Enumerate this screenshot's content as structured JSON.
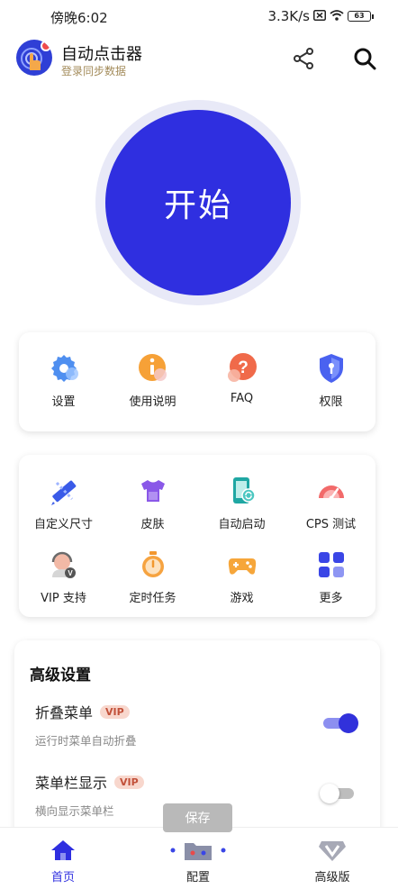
{
  "status_bar": {
    "time": "傍晚6:02",
    "speed": "3.3K/s",
    "battery": "63"
  },
  "header": {
    "title": "自动点击器",
    "subtitle": "登录同步数据"
  },
  "start": {
    "label": "开始"
  },
  "quick_menu": [
    {
      "label": "设置",
      "icon": "gear-icon"
    },
    {
      "label": "使用说明",
      "icon": "info-icon"
    },
    {
      "label": "FAQ",
      "icon": "question-icon"
    },
    {
      "label": "权限",
      "icon": "shield-icon"
    }
  ],
  "tools_row1": [
    {
      "label": "自定义尺寸",
      "icon": "ruler-icon"
    },
    {
      "label": "皮肤",
      "icon": "tshirt-icon"
    },
    {
      "label": "自动启动",
      "icon": "phone-sync-icon"
    },
    {
      "label": "CPS 测试",
      "icon": "speedometer-icon"
    }
  ],
  "tools_row2": [
    {
      "label": "VIP 支持",
      "icon": "support-agent-icon"
    },
    {
      "label": "定时任务",
      "icon": "stopwatch-icon"
    },
    {
      "label": "游戏",
      "icon": "gamepad-icon"
    },
    {
      "label": "更多",
      "icon": "grid-icon"
    }
  ],
  "advanced": {
    "title": "高级设置",
    "settings": [
      {
        "name": "折叠菜单",
        "badge": "VIP",
        "desc": "运行时菜单自动折叠",
        "enabled": true
      },
      {
        "name": "菜单栏显示",
        "badge": "VIP",
        "desc": "横向显示菜单栏",
        "enabled": false
      }
    ]
  },
  "save": {
    "label": "保存"
  },
  "bottom_nav": [
    {
      "label": "首页",
      "icon": "home-icon",
      "active": true
    },
    {
      "label": "配置",
      "icon": "folder-icon",
      "active": false
    },
    {
      "label": "高级版",
      "icon": "vip-diamond-icon",
      "active": false
    }
  ],
  "colors": {
    "primary": "#2f2fe0",
    "ring": "#e8e9f7",
    "vip_text": "#c2513a",
    "vip_bg": "#f8d7cd"
  }
}
